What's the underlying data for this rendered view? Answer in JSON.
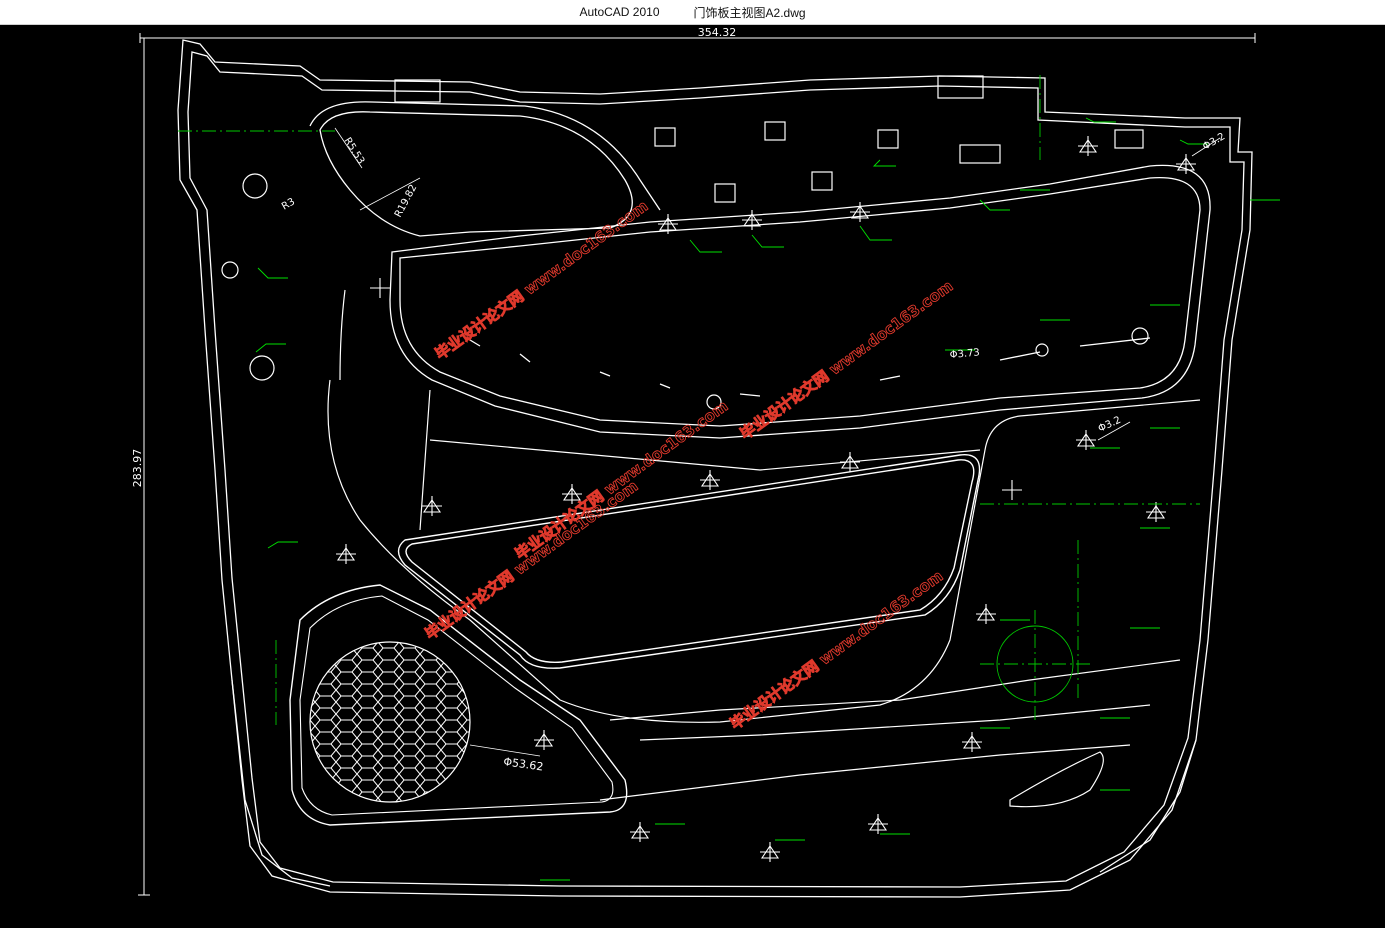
{
  "window": {
    "app_name": "AutoCAD 2010",
    "file_name": "门饰板主视图A2.dwg"
  },
  "colors": {
    "background": "#000000",
    "geometry": "#ffffff",
    "centerlines": "#00c800",
    "annotations": "#00e000",
    "watermark": "#e0392c"
  },
  "dimensions": {
    "overall_width": "354.32",
    "overall_height": "283.97",
    "radius_1": "R5.53",
    "radius_2": "R19.82",
    "radius_3": "R3",
    "diameter_hole_1": "Φ3.2",
    "diameter_hole_2": "Φ3.2",
    "diameter_hole_3": "Φ3.73",
    "speaker_diameter": "Φ53.62"
  },
  "watermarks": [
    "毕业设计论文网 www.doc163.com",
    "毕业设计论文网 www.doc163.com",
    "毕业设计论文网 www.doc163.com",
    "毕业设计论文网 www.doc163.com",
    "毕业设计论文网 www.doc163.com"
  ]
}
